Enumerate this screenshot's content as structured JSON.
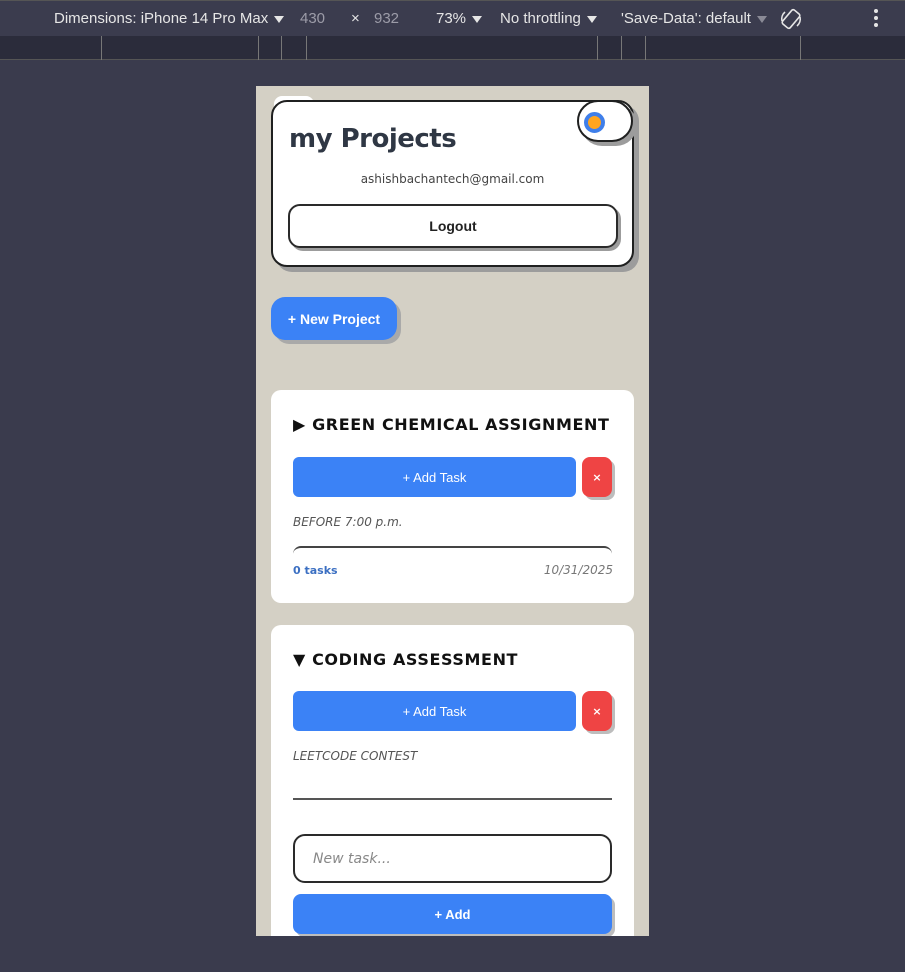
{
  "devtools": {
    "device_label": "Dimensions: iPhone 14 Pro Max",
    "width": "430",
    "times": "×",
    "height": "932",
    "zoom": "73%",
    "throttling": "No throttling",
    "save_data": "'Save-Data': default"
  },
  "header": {
    "title": "my Projects",
    "email": "ashishbachantech@gmail.com",
    "logout_label": "Logout"
  },
  "new_project_label": "+ New Project",
  "projects": [
    {
      "title": "▶ GREEN CHEMICAL ASSIGNMENT",
      "add_task_label": "+ Add Task",
      "delete_label": "×",
      "description": "BEFORE 7:00 p.m.",
      "task_count": "0 tasks",
      "date": "10/31/2025"
    },
    {
      "title": "▼ CODING ASSESSMENT",
      "add_task_label": "+ Add Task",
      "delete_label": "×",
      "description": "LEETCODE CONTEST",
      "new_task_placeholder": "New task...",
      "add_label": "+ Add"
    }
  ],
  "colors": {
    "accent": "#3b82f6",
    "danger": "#ef4444",
    "page_bg": "#d4d0c5"
  }
}
